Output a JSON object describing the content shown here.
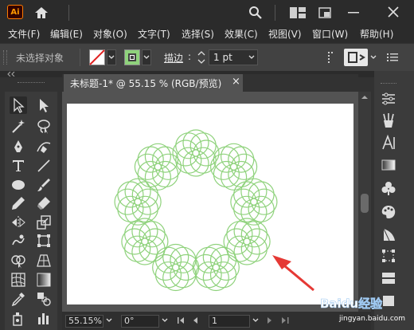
{
  "app": {
    "logo_text": "Ai"
  },
  "menu": [
    "文件(F)",
    "编辑(E)",
    "对象(O)",
    "文字(T)",
    "选择(S)",
    "效果(C)",
    "视图(V)",
    "窗口(W)",
    "帮助(H)"
  ],
  "control_bar": {
    "selection_label": "未选择对象",
    "stroke_label": "描边",
    "stroke_colon": ":",
    "stroke_weight": "1 pt"
  },
  "document": {
    "tab_title": "未标题-1* @ 55.15 % (RGB/预览)",
    "close_glyph": "×"
  },
  "status": {
    "zoom": "55.15%",
    "rotation": "0°",
    "artboard": "1"
  },
  "watermark": {
    "text": "Baidu经验",
    "sub": "jingyan.baidu.com"
  },
  "colors": {
    "stroke_green": "#8fd27c",
    "arrow_red": "#e53935",
    "app_bg": "#323232",
    "control_bg": "#424242"
  },
  "icons": [
    "home-icon",
    "search-icon",
    "arrange-icon",
    "window-icon",
    "minimize-icon",
    "close-icon",
    "selection-tool-icon",
    "direct-selection-tool-icon",
    "magic-wand-icon",
    "lasso-icon",
    "pen-icon",
    "curvature-icon",
    "type-icon",
    "line-icon",
    "ellipse-icon",
    "paintbrush-icon",
    "pencil-icon",
    "eraser-icon",
    "reflect-icon",
    "scale-icon",
    "warp-icon",
    "free-transform-icon",
    "shape-builder-icon",
    "perspective-icon",
    "mesh-icon",
    "gradient-icon",
    "eyedropper-icon",
    "blend-icon",
    "symbol-sprayer-icon",
    "graph-icon",
    "properties-icon",
    "brushes-icon",
    "character-icon",
    "gradient-panel-icon",
    "symbols-icon",
    "color-icon",
    "transparency-icon",
    "transform-icon",
    "layers-icon"
  ]
}
